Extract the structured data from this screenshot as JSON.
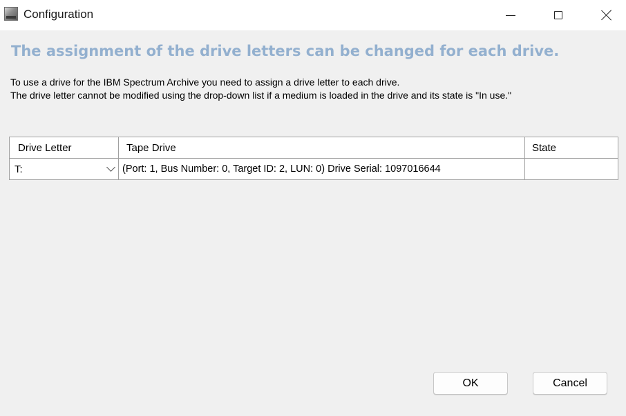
{
  "window": {
    "title": "Configuration",
    "icon": "tape-library-icon"
  },
  "heading": "The assignment of the drive letters can be changed for each drive.",
  "description": {
    "line1": "To use a drive for the IBM Spectrum Archive you need to assign a drive letter to each drive.",
    "line2": "The drive letter cannot be modified using the drop-down list if a medium is loaded in the drive and its state is \"In use.\""
  },
  "grid": {
    "columns": [
      "Drive Letter",
      "Tape Drive",
      "State"
    ],
    "rows": [
      {
        "drive_letter": "T:",
        "tape_drive": "(Port: 1, Bus Number: 0, Target ID: 2, LUN: 0) Drive Serial: 1097016644",
        "state": ""
      }
    ]
  },
  "buttons": {
    "ok": "OK",
    "cancel": "Cancel"
  },
  "colors": {
    "heading": "#93b0cf",
    "background": "#f0f0f0"
  }
}
